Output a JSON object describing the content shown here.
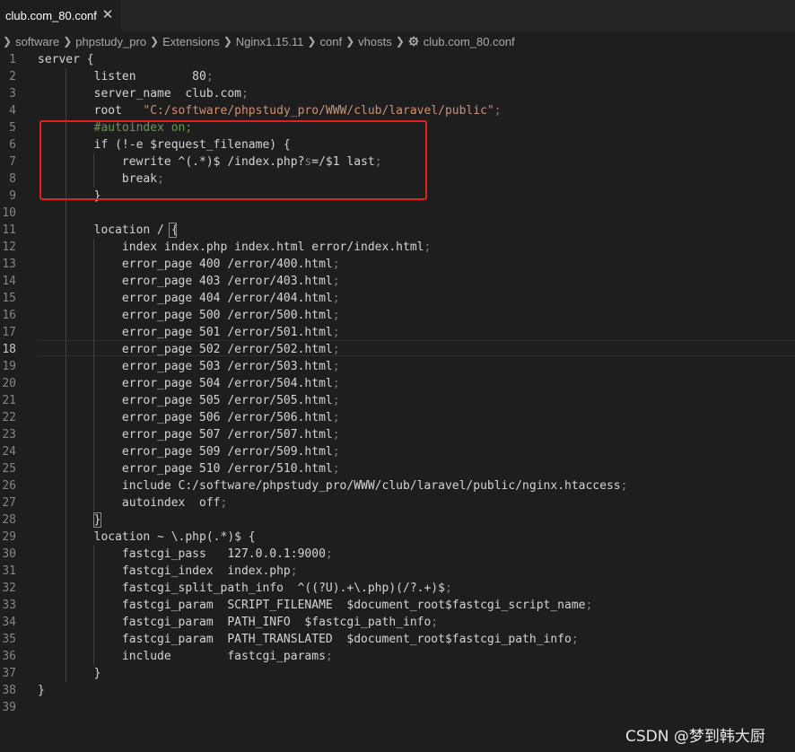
{
  "tab": {
    "label": "club.com_80.conf"
  },
  "icons": {
    "close": "close-icon",
    "gear": "gear-icon"
  },
  "breadcrumb": {
    "items": [
      "software",
      "phpstudy_pro",
      "Extensions",
      "Nginx1.15.11",
      "conf",
      "vhosts",
      "club.com_80.conf"
    ]
  },
  "editor": {
    "active_line": 18,
    "colors": {
      "text": "#d4d4d4",
      "string": "#ce9178",
      "comment": "#6a9955",
      "punct": "#808080",
      "highlight_border": "#e31f1f"
    },
    "highlight_lines": [
      5,
      9
    ],
    "lines": [
      [
        [
          "server {"
        ]
      ],
      [
        [
          "        listen        80"
        ],
        [
          ";",
          "punct"
        ]
      ],
      [
        [
          "        server_name  club.com"
        ],
        [
          ";",
          "punct"
        ]
      ],
      [
        [
          "        root   "
        ],
        [
          "\"C:/software/phpstudy_pro/WWW/club/laravel/public\"",
          "string"
        ],
        [
          ";",
          "punct"
        ]
      ],
      [
        [
          "        "
        ],
        [
          "#autoindex on;",
          "comment"
        ]
      ],
      [
        [
          "        if (!-e $request_filename) {"
        ]
      ],
      [
        [
          "            rewrite ^(.*)$ /index.php?"
        ],
        [
          "s",
          "punct"
        ],
        [
          "=/$1 last"
        ],
        [
          ";",
          "punct"
        ]
      ],
      [
        [
          "            break"
        ],
        [
          ";",
          "punct"
        ]
      ],
      [
        [
          "        }"
        ]
      ],
      [
        [
          ""
        ]
      ],
      [
        [
          "        location / {"
        ]
      ],
      [
        [
          "            index index.php index.html error/index.html"
        ],
        [
          ";",
          "punct"
        ]
      ],
      [
        [
          "            error_page 400 /error/400.html"
        ],
        [
          ";",
          "punct"
        ]
      ],
      [
        [
          "            error_page 403 /error/403.html"
        ],
        [
          ";",
          "punct"
        ]
      ],
      [
        [
          "            error_page 404 /error/404.html"
        ],
        [
          ";",
          "punct"
        ]
      ],
      [
        [
          "            error_page 500 /error/500.html"
        ],
        [
          ";",
          "punct"
        ]
      ],
      [
        [
          "            error_page 501 /error/501.html"
        ],
        [
          ";",
          "punct"
        ]
      ],
      [
        [
          "            error_page 502 /error/502.html"
        ],
        [
          ";",
          "punct"
        ]
      ],
      [
        [
          "            error_page 503 /error/503.html"
        ],
        [
          ";",
          "punct"
        ]
      ],
      [
        [
          "            error_page 504 /error/504.html"
        ],
        [
          ";",
          "punct"
        ]
      ],
      [
        [
          "            error_page 505 /error/505.html"
        ],
        [
          ";",
          "punct"
        ]
      ],
      [
        [
          "            error_page 506 /error/506.html"
        ],
        [
          ";",
          "punct"
        ]
      ],
      [
        [
          "            error_page 507 /error/507.html"
        ],
        [
          ";",
          "punct"
        ]
      ],
      [
        [
          "            error_page 509 /error/509.html"
        ],
        [
          ";",
          "punct"
        ]
      ],
      [
        [
          "            error_page 510 /error/510.html"
        ],
        [
          ";",
          "punct"
        ]
      ],
      [
        [
          "            include C:/software/phpstudy_pro/WWW/club/laravel/public/nginx.htaccess"
        ],
        [
          ";",
          "punct"
        ]
      ],
      [
        [
          "            autoindex  off"
        ],
        [
          ";",
          "punct"
        ]
      ],
      [
        [
          "        }"
        ]
      ],
      [
        [
          "        location ~ \\.php(.*)$ {"
        ]
      ],
      [
        [
          "            fastcgi_pass   127.0.0.1:9000"
        ],
        [
          ";",
          "punct"
        ]
      ],
      [
        [
          "            fastcgi_index  index.php"
        ],
        [
          ";",
          "punct"
        ]
      ],
      [
        [
          "            fastcgi_split_path_info  ^((?U).+\\.php)(/?.+)$"
        ],
        [
          ";",
          "punct"
        ]
      ],
      [
        [
          "            fastcgi_param  SCRIPT_FILENAME  $document_root$fastcgi_script_name"
        ],
        [
          ";",
          "punct"
        ]
      ],
      [
        [
          "            fastcgi_param  PATH_INFO  $fastcgi_path_info"
        ],
        [
          ";",
          "punct"
        ]
      ],
      [
        [
          "            fastcgi_param  PATH_TRANSLATED  $document_root$fastcgi_path_info"
        ],
        [
          ";",
          "punct"
        ]
      ],
      [
        [
          "            include        fastcgi_params"
        ],
        [
          ";",
          "punct"
        ]
      ],
      [
        [
          "        }"
        ]
      ],
      [
        [
          "}"
        ]
      ],
      [
        [
          ""
        ]
      ]
    ]
  },
  "watermark": {
    "text": "CSDN @梦到韩大厨"
  }
}
